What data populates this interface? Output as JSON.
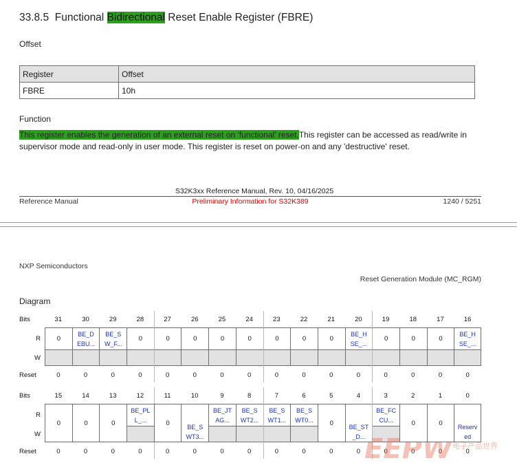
{
  "section": {
    "number": "33.8.5",
    "title_pre": "Functional ",
    "title_highlight": "Bidirectional",
    "title_post": " Reset Enable Register (FBRE)"
  },
  "offset_section": {
    "label": "Offset",
    "headers": [
      "Register",
      "Offset"
    ],
    "row": [
      "FBRE",
      "10h"
    ]
  },
  "function_section": {
    "label": "Function",
    "highlight": "This register enables the generation of an external reset on 'functional' reset.",
    "text": "This register can be accessed as read/write in supervisor mode and read-only in user mode. This register is reset on power-on and any 'destructive' reset."
  },
  "footer": {
    "center": "S32K3xx Reference Manual, Rev. 10, 04/16/2025",
    "left": "Reference Manual",
    "mid": "Preliminary Information for S32K389",
    "right": "1240 / 5251"
  },
  "header2": {
    "company": "NXP Semiconductors",
    "module": "Reset Generation Module (MC_RGM)"
  },
  "diagram": {
    "label": "Diagram",
    "row_labels": {
      "bits": "Bits",
      "r": "R",
      "w": "W",
      "reset": "Reset"
    },
    "upper": {
      "bits": [
        "31",
        "30",
        "29",
        "28",
        "27",
        "26",
        "25",
        "24",
        "23",
        "22",
        "21",
        "20",
        "19",
        "18",
        "17",
        "16"
      ],
      "r": [
        "0",
        "BE_D EBU...",
        "BE_S W_F...",
        "0",
        "0",
        "0",
        "0",
        "0",
        "0",
        "0",
        "0",
        "BE_H SE_...",
        "0",
        "0",
        "0",
        "BE_H SE_..."
      ],
      "reset": [
        "0",
        "0",
        "0",
        "0",
        "0",
        "0",
        "0",
        "0",
        "0",
        "0",
        "0",
        "0",
        "0",
        "0",
        "0",
        "0"
      ]
    },
    "lower": {
      "bits": [
        "15",
        "14",
        "13",
        "12",
        "11",
        "10",
        "9",
        "8",
        "7",
        "6",
        "5",
        "4",
        "3",
        "2",
        "1",
        "0"
      ],
      "r": [
        "0",
        "0",
        "0",
        "BE_PL L_...",
        "0",
        "BE_S WT3...",
        "BE_JT AG...",
        "BE_S WT2...",
        "BE_S WT1...",
        "BE_S WT0...",
        "0",
        "BE_ST _D...",
        "BE_FC CU...",
        "0",
        "0",
        "Reserv ed"
      ],
      "reset": [
        "0",
        "0",
        "0",
        "0",
        "0",
        "0",
        "0",
        "0",
        "0",
        "0",
        "0",
        "0",
        "0",
        "0",
        "0",
        "0"
      ]
    }
  },
  "watermark": {
    "logo": "EEPW",
    "tagline": "电子产品世界"
  }
}
